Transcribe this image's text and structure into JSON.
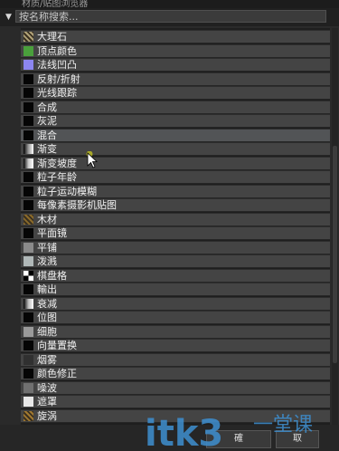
{
  "window": {
    "title": "材质/贴图浏览器"
  },
  "search": {
    "placeholder": "按名称搜索..."
  },
  "items": [
    {
      "label": "大理石",
      "swatch": "#b0a278"
    },
    {
      "label": "顶点颜色",
      "swatch": "#4aa03c"
    },
    {
      "label": "法线凹凸",
      "swatch": "#8c86f0"
    },
    {
      "label": "反射/折射",
      "swatch": "#050505"
    },
    {
      "label": "光线跟踪",
      "swatch": "#050505"
    },
    {
      "label": "合成",
      "swatch": "#050505"
    },
    {
      "label": "灰泥",
      "swatch": "#050505"
    },
    {
      "label": "混合",
      "swatch": "#050505"
    },
    {
      "label": "渐变",
      "swatch": "#9a9a9a"
    },
    {
      "label": "渐变坡度",
      "swatch": "#c8c8c8"
    },
    {
      "label": "粒子年龄",
      "swatch": "#050505"
    },
    {
      "label": "粒子运动模糊",
      "swatch": "#050505"
    },
    {
      "label": "每像素摄影机贴图",
      "swatch": "#050505"
    },
    {
      "label": "木材",
      "swatch": "#8a6a2a"
    },
    {
      "label": "平面镜",
      "swatch": "#050505"
    },
    {
      "label": "平铺",
      "swatch": "#8a8a8a"
    },
    {
      "label": "泼溅",
      "swatch": "#b0b8b8"
    },
    {
      "label": "棋盘格",
      "swatch": "#ffffff"
    },
    {
      "label": "輸出",
      "swatch": "#050505"
    },
    {
      "label": "衰减",
      "swatch": "#bdbdbd"
    },
    {
      "label": "位图",
      "swatch": "#050505"
    },
    {
      "label": "细胞",
      "swatch": "#9a9a9a"
    },
    {
      "label": "向量置换",
      "swatch": "#050505"
    },
    {
      "label": "烟雾",
      "swatch": "#303030"
    },
    {
      "label": "颜色修正",
      "swatch": "#050505"
    },
    {
      "label": "噪波",
      "swatch": "#707070"
    },
    {
      "label": "遮罩",
      "swatch": "#e8e8e8"
    },
    {
      "label": "旋涡",
      "swatch": "#a07830"
    }
  ],
  "highlighted_index": 7,
  "buttons": {
    "ok": "確",
    "cancel": "取"
  },
  "watermark": {
    "text": "itk3",
    "subtext": "一堂课",
    "color": "#3e8fd0"
  }
}
